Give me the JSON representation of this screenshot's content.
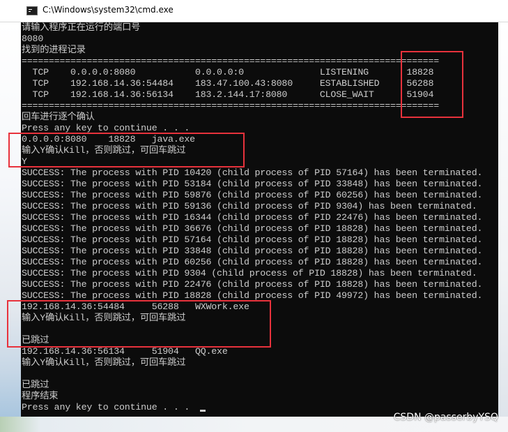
{
  "window": {
    "title": "C:\\Windows\\system32\\cmd.exe",
    "icon": "cmd-icon"
  },
  "console": {
    "lines": [
      "请输入程序正在运行的端口号",
      "8080",
      "找到的进程记录",
      "=============================================================================",
      "  TCP    0.0.0.0:8080           0.0.0.0:0              LISTENING       18828",
      "  TCP    192.168.14.36:54484    183.47.100.43:8080     ESTABLISHED     56288",
      "  TCP    192.168.14.36:56134    183.2.144.17:8080      CLOSE_WAIT      51904",
      "=============================================================================",
      "回车进行逐个确认",
      "Press any key to continue . . .",
      "0.0.0.0:8080    18828   java.exe",
      "输入Y确认Kill，否则跳过，可回车跳过",
      "Y",
      "SUCCESS: The process with PID 10420 (child process of PID 57164) has been terminated.",
      "SUCCESS: The process with PID 53184 (child process of PID 33848) has been terminated.",
      "SUCCESS: The process with PID 59876 (child process of PID 60256) has been terminated.",
      "SUCCESS: The process with PID 59136 (child process of PID 9304) has been terminated.",
      "SUCCESS: The process with PID 16344 (child process of PID 22476) has been terminated.",
      "SUCCESS: The process with PID 36676 (child process of PID 18828) has been terminated.",
      "SUCCESS: The process with PID 57164 (child process of PID 18828) has been terminated.",
      "SUCCESS: The process with PID 33848 (child process of PID 18828) has been terminated.",
      "SUCCESS: The process with PID 60256 (child process of PID 18828) has been terminated.",
      "SUCCESS: The process with PID 9304 (child process of PID 18828) has been terminated.",
      "SUCCESS: The process with PID 22476 (child process of PID 18828) has been terminated.",
      "SUCCESS: The process with PID 18828 (child process of PID 49972) has been terminated.",
      "192.168.14.36:54484     56288   WXWork.exe",
      "输入Y确认Kill，否则跳过，可回车跳过",
      "",
      "已跳过",
      "192.168.14.36:56134     51904   QQ.exe",
      "输入Y确认Kill，否则跳过，可回车跳过",
      "",
      "已跳过",
      "程序结束",
      "Press any key to continue . . . "
    ]
  },
  "watermark": "CSDN @passerbyYSQ",
  "colors": {
    "console_bg": "#0c0c0c",
    "console_text": "#cccccc",
    "highlight_box": "#e8323c"
  }
}
